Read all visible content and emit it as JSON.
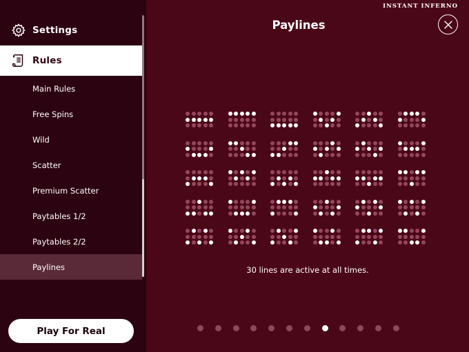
{
  "brand": {
    "name": "INSTANT INFERNO"
  },
  "sidebar": {
    "settings_label": "Settings",
    "rules_label": "Rules",
    "items": [
      {
        "label": "Main Rules",
        "active": false
      },
      {
        "label": "Free Spins",
        "active": false
      },
      {
        "label": "Wild",
        "active": false
      },
      {
        "label": "Scatter",
        "active": false
      },
      {
        "label": "Premium Scatter",
        "active": false
      },
      {
        "label": "Paytables 1/2",
        "active": false
      },
      {
        "label": "Paytables 2/2",
        "active": false
      },
      {
        "label": "Paylines",
        "active": true
      }
    ],
    "play_button_label": "Play For Real"
  },
  "main": {
    "title": "Paylines",
    "caption": "30 lines are active at all times."
  },
  "paylines": [
    [
      1,
      1,
      1,
      1,
      1
    ],
    [
      0,
      0,
      0,
      0,
      0
    ],
    [
      2,
      2,
      2,
      2,
      2
    ],
    [
      0,
      1,
      2,
      1,
      0
    ],
    [
      2,
      1,
      0,
      1,
      2
    ],
    [
      1,
      0,
      0,
      0,
      1
    ],
    [
      1,
      2,
      2,
      2,
      1
    ],
    [
      0,
      0,
      1,
      2,
      2
    ],
    [
      2,
      2,
      1,
      0,
      0
    ],
    [
      1,
      2,
      1,
      0,
      1
    ],
    [
      1,
      0,
      1,
      2,
      1
    ],
    [
      0,
      1,
      1,
      1,
      0
    ],
    [
      2,
      1,
      1,
      1,
      2
    ],
    [
      0,
      1,
      0,
      1,
      0
    ],
    [
      2,
      1,
      2,
      1,
      2
    ],
    [
      1,
      1,
      0,
      1,
      1
    ],
    [
      1,
      1,
      2,
      1,
      1
    ],
    [
      0,
      0,
      2,
      0,
      0
    ],
    [
      2,
      2,
      0,
      2,
      2
    ],
    [
      0,
      2,
      2,
      2,
      0
    ],
    [
      2,
      0,
      0,
      0,
      2
    ],
    [
      1,
      2,
      0,
      2,
      1
    ],
    [
      1,
      0,
      2,
      0,
      1
    ],
    [
      0,
      2,
      0,
      2,
      0
    ],
    [
      2,
      0,
      2,
      0,
      2
    ],
    [
      0,
      2,
      1,
      0,
      2
    ],
    [
      2,
      0,
      1,
      2,
      0
    ],
    [
      0,
      2,
      2,
      0,
      2
    ],
    [
      2,
      0,
      0,
      2,
      0
    ],
    [
      0,
      0,
      2,
      2,
      0
    ]
  ],
  "colors": {
    "background": "#4a0718",
    "sidebar": "#2c0310",
    "dot_off": "#95475c",
    "dot_on": "#ffffff",
    "active_item": "#5a2a38"
  },
  "pagination": {
    "total": 12,
    "active_index": 7
  }
}
